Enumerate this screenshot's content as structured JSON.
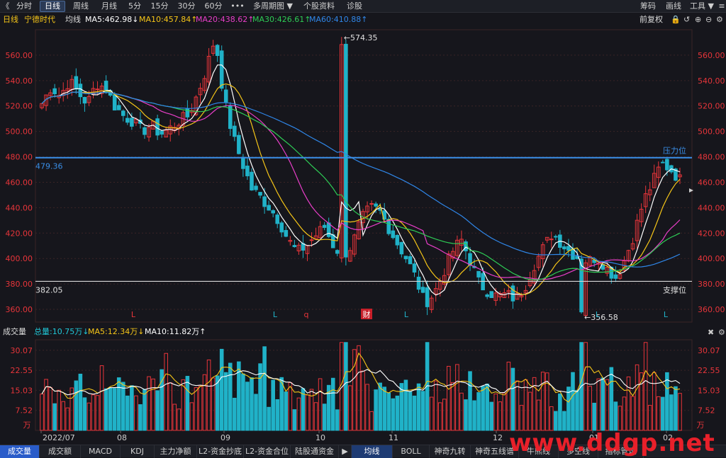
{
  "toolbar": {
    "back": "《",
    "tabs": [
      "分时",
      "日线",
      "周线",
      "月线",
      "5分",
      "15分",
      "30分",
      "60分",
      "•••",
      "多周期图 ▼",
      "个股资料",
      "诊股"
    ],
    "active_index": 1,
    "right": [
      "筹码",
      "画线",
      "工具 ▼"
    ]
  },
  "ma_bar": {
    "period": "日线",
    "name": "宁德时代",
    "label": "均线",
    "ma5": "MA5:462.98↓",
    "ma10": "MA10:457.84↑",
    "ma20": "MA20:438.62↑",
    "ma30": "MA30:426.61↑",
    "ma60": "MA60:410.88↑",
    "fq": "前复权"
  },
  "colors": {
    "up": "#e8353a",
    "down": "#20b2c8",
    "ma5": "#ffffff",
    "ma10": "#f5c518",
    "ma20": "#e83ec8",
    "ma30": "#2ecc55",
    "ma60": "#2f86e8",
    "resistance": "#3a8fe8",
    "support": "#d8d8d8"
  },
  "price_axis": {
    "min": 350,
    "max": 580,
    "ticks": [
      "560.00",
      "540.00",
      "520.00",
      "500.00",
      "480.00",
      "460.00",
      "440.00",
      "420.00",
      "400.00",
      "380.00",
      "360.00"
    ]
  },
  "annotations": {
    "high": "←574.35",
    "low": "←356.58",
    "resistance_value": "479.36",
    "resistance_label": "压力位",
    "support_value": "382.05",
    "support_label": "支撑位",
    "signals": [
      {
        "text": "L",
        "color": "#e8353a"
      },
      {
        "text": "L",
        "color": "#20b2c8"
      },
      {
        "text": "q",
        "color": "#e8353a"
      },
      {
        "text": "财",
        "color": "#ffffff"
      },
      {
        "text": "L",
        "color": "#20b2c8"
      },
      {
        "text": "L",
        "color": "#20b2c8"
      },
      {
        "text": "L",
        "color": "#20b2c8"
      }
    ]
  },
  "volume": {
    "title": "成交量",
    "total": "总量:10.75万↓",
    "ma5": "MA5:12.34万↓",
    "ma10": "MA10:11.82万↑",
    "ticks": [
      "30.07",
      "22.55",
      "15.03",
      "7.52"
    ],
    "unit": "万"
  },
  "dates": [
    "2022/07",
    "08",
    "09",
    "10",
    "11",
    "12",
    "01",
    "02"
  ],
  "bottom_tabs": [
    "成交量",
    "成交额",
    "MACD",
    "KDJ",
    "主力净额",
    "L2-资金抄底",
    "L2-资金合位",
    "陆股通资金",
    "均线",
    "BOLL",
    "神奇九转",
    "神奇五线谱",
    "牛熊线",
    "多空线",
    "指标管理"
  ],
  "watermark": "www.ddgp.net",
  "chart_data": {
    "type": "candlestick",
    "price_range": [
      350,
      580
    ],
    "resistance": 479.36,
    "support": 382.05,
    "high": 574.35,
    "low": 356.58,
    "close_path": [
      522,
      535,
      528,
      540,
      530,
      522,
      538,
      534,
      520,
      512,
      508,
      500,
      505,
      498,
      502,
      508,
      512,
      528,
      548,
      574,
      525,
      495,
      475,
      455,
      448,
      440,
      430,
      415,
      405,
      410,
      418,
      425,
      410,
      402,
      410,
      430,
      440,
      438,
      425,
      412,
      400,
      385,
      365,
      372,
      388,
      405,
      415,
      398,
      380,
      374,
      370,
      372,
      368,
      378,
      395,
      408,
      420,
      412,
      405,
      400,
      398,
      402,
      392,
      385,
      400,
      420,
      445,
      460,
      475,
      470,
      462
    ],
    "volume_range": [
      0,
      34
    ]
  }
}
